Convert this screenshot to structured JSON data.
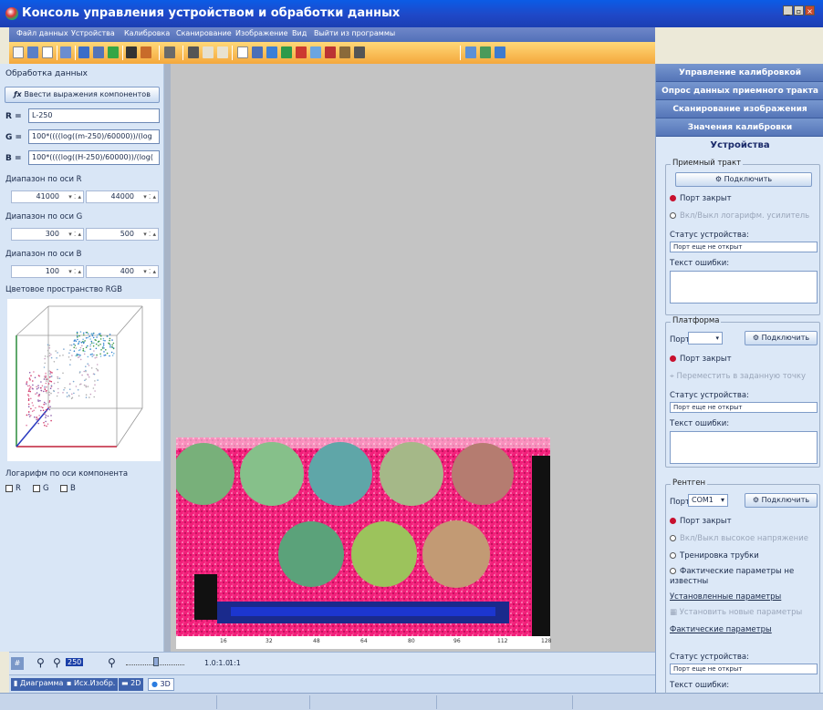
{
  "window": {
    "title": "Консоль управления устройством и обработки данных"
  },
  "menu": [
    "Файл данных",
    "Устройства",
    "Калибровка",
    "Сканирование",
    "Изображение",
    "Вид",
    "Выйти из программы"
  ],
  "left": {
    "title": "Обработка данных",
    "enter_expr_btn": "Ввести выражения компонентов",
    "r_label": "R =",
    "r_value": "L-250",
    "g_label": "G =",
    "g_value": "100*((((log((m-250)/60000))/(log",
    "b_label": "B =",
    "b_value": "100*((((log((H-250)/60000))/(log(",
    "range_r_label": "Диапазон по оси R",
    "range_r_min": "41000",
    "range_r_max": "44000",
    "range_g_label": "Диапазон по оси G",
    "range_g_min": "300",
    "range_g_max": "500",
    "range_b_label": "Диапазон по оси B",
    "range_b_min": "100",
    "range_b_max": "400",
    "color_space_label": "Цветовое пространство RGB",
    "log_label": "Логарифм по оси компонента",
    "log_r": "R",
    "log_g": "G",
    "log_b": "B"
  },
  "image_axis": {
    "ticks": [
      "16",
      "32",
      "48",
      "64",
      "80",
      "96",
      "112",
      "128"
    ]
  },
  "zoom": {
    "value": "250",
    "ratio": "1.0:1.0",
    "one": "1:1"
  },
  "tabs": [
    "Диаграмма",
    "Исх.Изобр.",
    "2D",
    "3D"
  ],
  "right": {
    "sections": [
      "Управление калибровкой",
      "Опрос данных приемного тракта",
      "Сканирование изображения",
      "Значения калибровки"
    ],
    "devices_title": "Устройства",
    "receiver": {
      "title": "Приемный тракт",
      "connect": "Подключить",
      "port_closed": "Порт закрыт",
      "log_amp": "Вкл/Выкл логарифм. усилитель",
      "status_label": "Статус устройства:",
      "status_value": "Порт еще не открыт",
      "error_label": "Текст ошибки:"
    },
    "platform": {
      "title": "Платформа",
      "port_label": "Порт",
      "port_value": "",
      "connect": "Подключить",
      "port_closed": "Порт закрыт",
      "move": "Переместить в заданную точку",
      "status_label": "Статус устройства:",
      "status_value": "Порт еще не открыт",
      "error_label": "Текст ошибки:"
    },
    "xray": {
      "title": "Рентген",
      "port_label": "Порт",
      "port_value": "COM1",
      "connect": "Подключить",
      "port_closed": "Порт закрыт",
      "high_voltage": "Вкл/Выкл высокое напряжение",
      "tube_training": "Тренировка трубки",
      "actual_unknown": "Фактические параметры не известны",
      "set_params_label": "Установленные параметры",
      "set_new_params": "Установить новые параметры",
      "actual_params_label": "Фактические параметры",
      "status_label": "Статус устройства:",
      "status_value": "Порт еще не открыт",
      "error_label": "Текст ошибки:"
    }
  }
}
